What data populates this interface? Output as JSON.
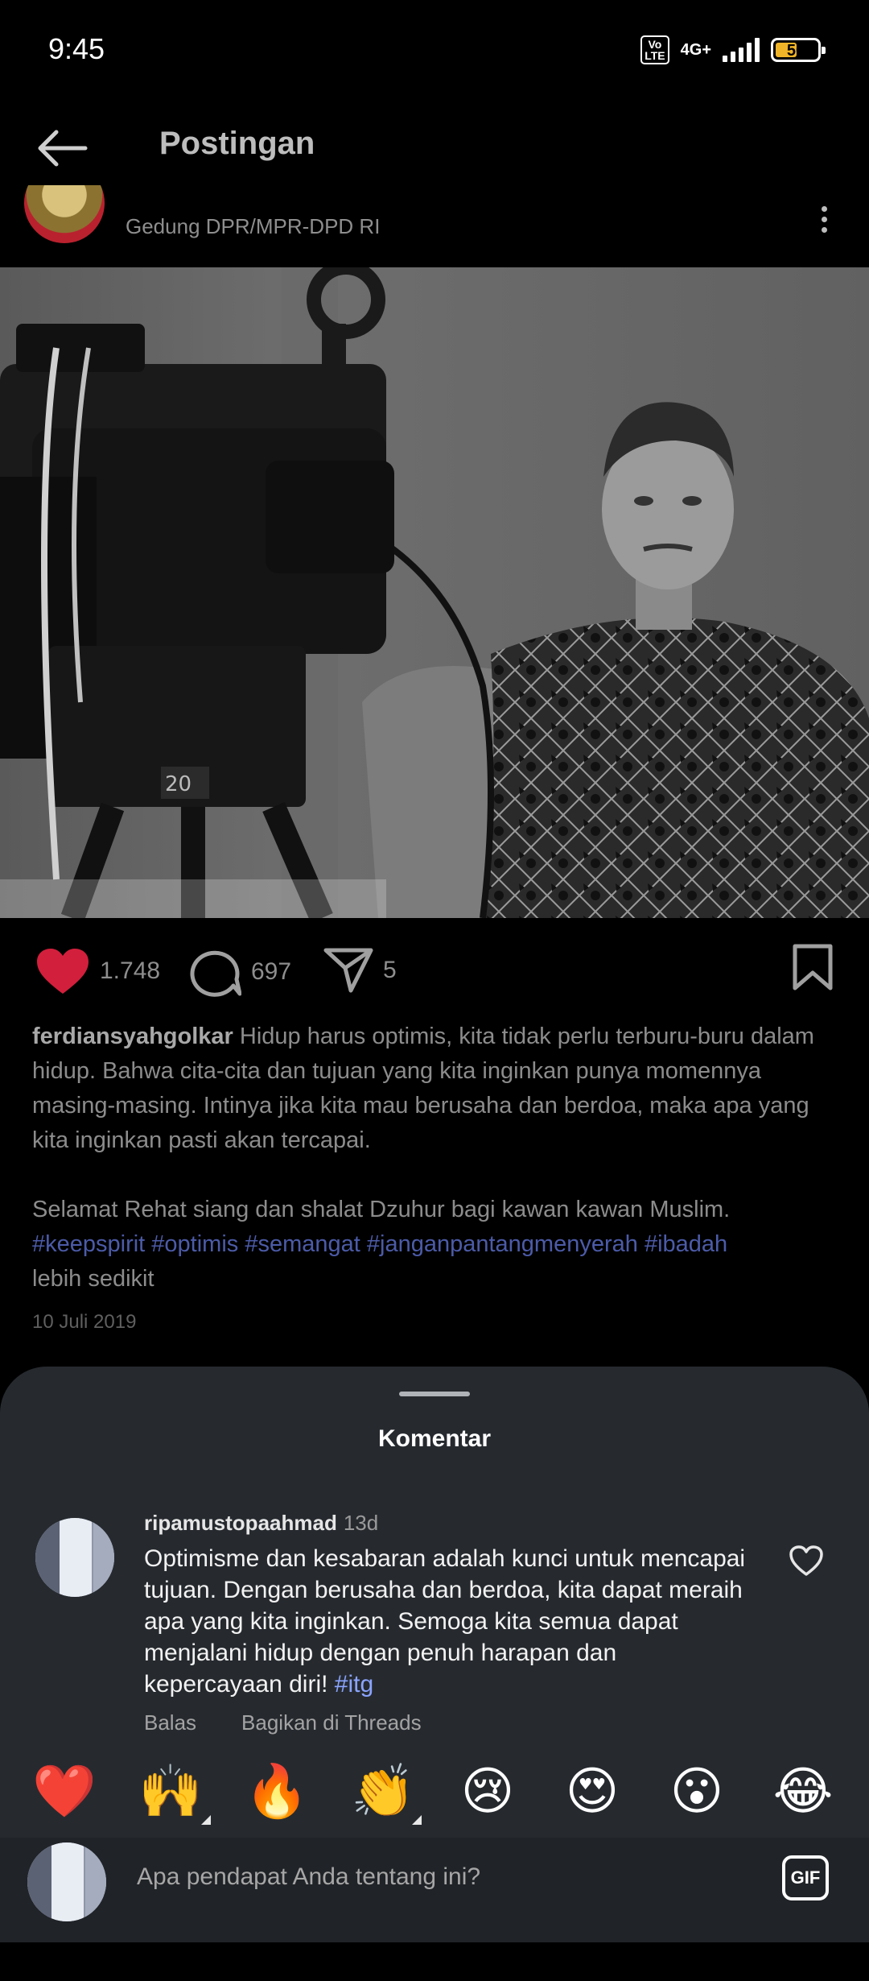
{
  "status_bar": {
    "time": "9:45",
    "volte": "Vo\nLTE",
    "network": "4G+",
    "battery": "50"
  },
  "header": {
    "title": "Postingan",
    "back_icon": "arrow-left-icon"
  },
  "post": {
    "location": "Gedung DPR/MPR-DPD RI",
    "likes": "1.748",
    "comments": "697",
    "shares": "5",
    "username": "ferdiansyahgolkar",
    "caption_line1": " Hidup harus optimis, kita tidak perlu terburu-buru dalam hidup. Bahwa cita-cita dan tujuan yang kita inginkan punya momennya masing-masing. Intinya jika kita mau berusaha dan berdoa, maka apa yang kita inginkan pasti akan tercapai.",
    "caption_line2": "Selamat Rehat siang dan shalat Dzuhur bagi kawan kawan Muslim.",
    "hashtags": "#keepspirit #optimis #semangat #janganpantangmenyerah #ibadah",
    "more": "lebih sedikit",
    "date": "10 Juli 2019",
    "like_color": "#d21f3c"
  },
  "comments_sheet": {
    "title": "Komentar",
    "comment": {
      "user": "ripamustopaahmad",
      "time": "13d",
      "text": "Optimisme dan kesabaran adalah kunci untuk mencapai tujuan. Dengan berusaha dan berdoa, kita dapat meraih apa yang kita inginkan. Semoga kita semua dapat menjalani hidup dengan penuh harapan dan kepercayaan diri! ",
      "tag": "#itg",
      "reply": "Balas",
      "share_threads": "Bagikan di Threads"
    },
    "reactions": [
      "❤️",
      "🙌",
      "🔥",
      "👏",
      "😢",
      "😍",
      "😮",
      "😂"
    ],
    "input_placeholder": "Apa pendapat Anda tentang ini?",
    "gif_label": "GIF"
  }
}
